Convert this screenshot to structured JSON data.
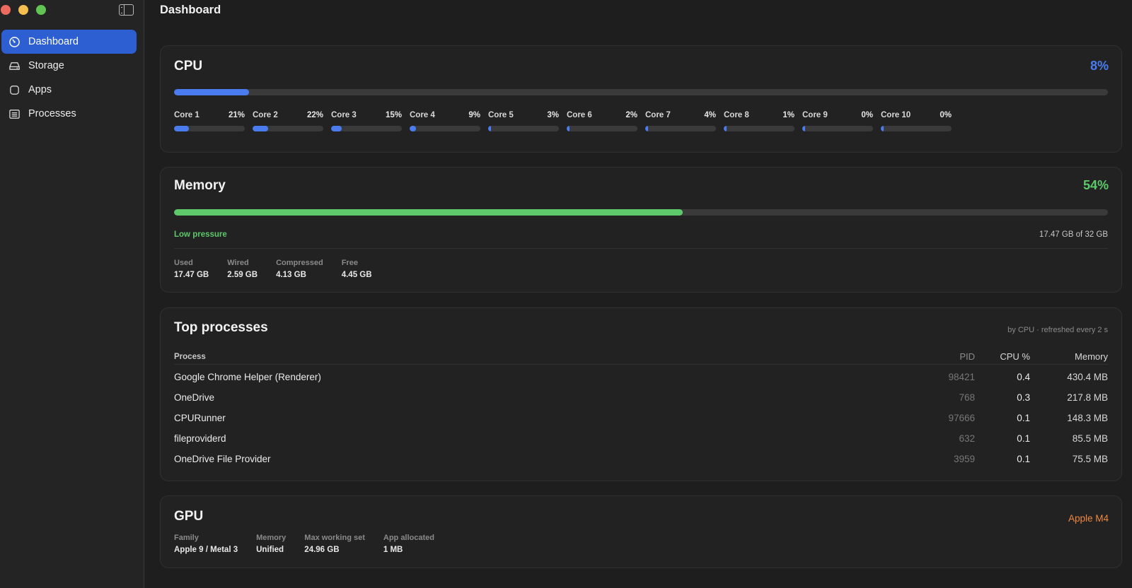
{
  "window": {
    "title": "Dashboard"
  },
  "sidebar": {
    "items": [
      {
        "label": "Dashboard",
        "icon": "gauge-icon",
        "active": true
      },
      {
        "label": "Storage",
        "icon": "drive-icon",
        "active": false
      },
      {
        "label": "Apps",
        "icon": "app-square-icon",
        "active": false
      },
      {
        "label": "Processes",
        "icon": "list-icon",
        "active": false
      }
    ]
  },
  "cpu": {
    "title": "CPU",
    "total_label": "8%",
    "total_fraction": 0.08,
    "accent": "#4a7cf0",
    "cores": [
      {
        "label": "Core 1",
        "pct_label": "21%",
        "fraction": 0.21
      },
      {
        "label": "Core 2",
        "pct_label": "22%",
        "fraction": 0.22
      },
      {
        "label": "Core 3",
        "pct_label": "15%",
        "fraction": 0.15
      },
      {
        "label": "Core 4",
        "pct_label": "9%",
        "fraction": 0.09
      },
      {
        "label": "Core 5",
        "pct_label": "3%",
        "fraction": 0.03
      },
      {
        "label": "Core 6",
        "pct_label": "2%",
        "fraction": 0.02
      },
      {
        "label": "Core 7",
        "pct_label": "4%",
        "fraction": 0.04
      },
      {
        "label": "Core 8",
        "pct_label": "1%",
        "fraction": 0.01
      },
      {
        "label": "Core 9",
        "pct_label": "0%",
        "fraction": 0.0
      },
      {
        "label": "Core 10",
        "pct_label": "0%",
        "fraction": 0.0
      }
    ]
  },
  "memory": {
    "title": "Memory",
    "total_label": "54%",
    "total_fraction": 0.545,
    "accent": "#5dc96b",
    "pressure": "Low pressure",
    "usage_text": "17.47 GB of 32 GB",
    "stats": [
      {
        "label": "Used",
        "value": "17.47 GB"
      },
      {
        "label": "Wired",
        "value": "2.59 GB"
      },
      {
        "label": "Compressed",
        "value": "4.13 GB"
      },
      {
        "label": "Free",
        "value": "4.45 GB"
      }
    ]
  },
  "processes": {
    "title": "Top processes",
    "note": "by CPU · refreshed every 2 s",
    "columns": {
      "name": "Process",
      "pid": "PID",
      "cpu": "CPU %",
      "memory": "Memory"
    },
    "rows": [
      {
        "name": "Google Chrome Helper (Renderer)",
        "pid": "98421",
        "cpu": "0.4",
        "memory": "430.4 MB"
      },
      {
        "name": "OneDrive",
        "pid": "768",
        "cpu": "0.3",
        "memory": "217.8 MB"
      },
      {
        "name": "CPURunner",
        "pid": "97666",
        "cpu": "0.1",
        "memory": "148.3 MB"
      },
      {
        "name": "fileproviderd",
        "pid": "632",
        "cpu": "0.1",
        "memory": "85.5 MB"
      },
      {
        "name": "OneDrive File Provider",
        "pid": "3959",
        "cpu": "0.1",
        "memory": "75.5 MB"
      }
    ]
  },
  "gpu": {
    "title": "GPU",
    "brand": "Apple M4",
    "brand_color": "#f0883e",
    "stats": [
      {
        "label": "Family",
        "value": "Apple 9 / Metal 3"
      },
      {
        "label": "Memory",
        "value": "Unified"
      },
      {
        "label": "Max working set",
        "value": "24.96 GB"
      },
      {
        "label": "App allocated",
        "value": "1 MB"
      }
    ]
  }
}
